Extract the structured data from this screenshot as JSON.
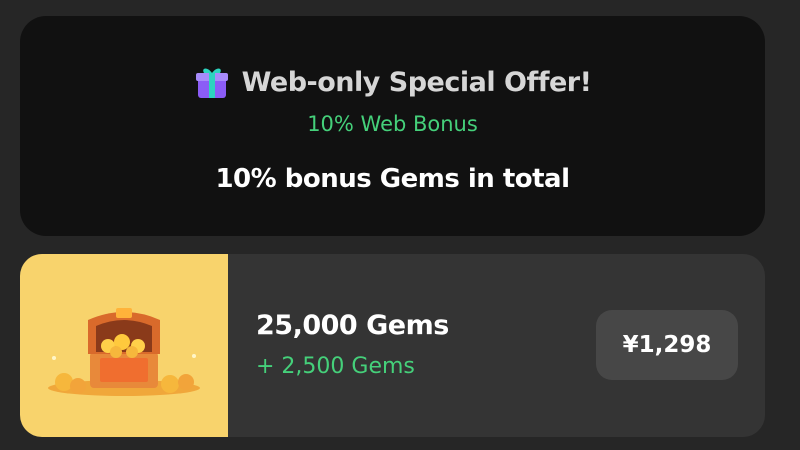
{
  "offer": {
    "icon": "gift-icon",
    "title": "Web-only Special Offer!",
    "web_bonus": "10% Web Bonus",
    "bonus_total": "10% bonus Gems in total"
  },
  "pack": {
    "image_icon": "treasure-chest-icon",
    "amount": "25,000 Gems",
    "bonus": "+ 2,500 Gems",
    "price": "¥1,298"
  },
  "colors": {
    "page_background": "#262626",
    "offer_card_background": "#111111",
    "pack_card_background": "#343434",
    "pack_image_background": "#f8d36c",
    "price_button_background": "#474747",
    "bonus_green": "#45d07a"
  }
}
